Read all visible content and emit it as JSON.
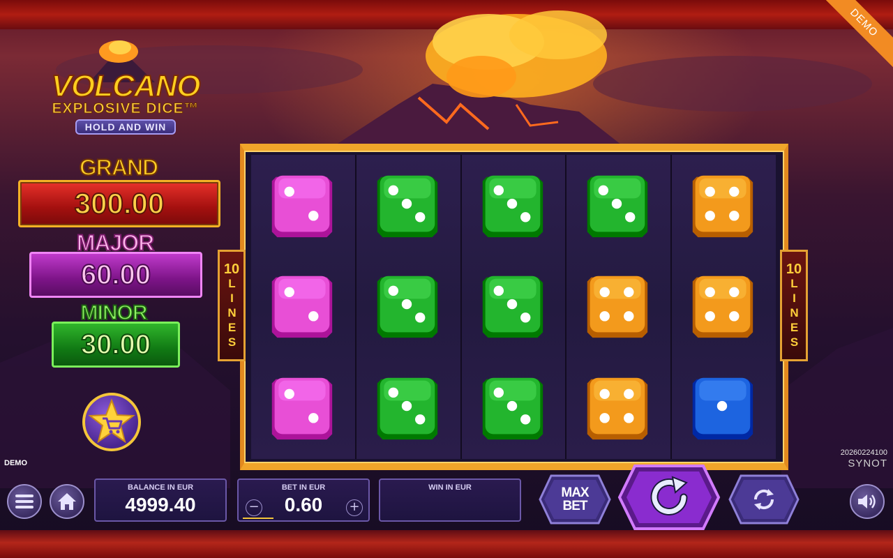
{
  "corner_badge": "DEMO",
  "logo": {
    "title": "VOLCANO",
    "subtitle": "EXPLOSIVE DICE™",
    "pill": "HOLD AND WIN"
  },
  "jackpots": {
    "grand": {
      "label": "GRAND",
      "value": "300.00"
    },
    "major": {
      "label": "MAJOR",
      "value": "60.00"
    },
    "minor": {
      "label": "MINOR",
      "value": "30.00"
    }
  },
  "lines": {
    "count": "10",
    "word": "LINES"
  },
  "reels": [
    [
      "pink-2",
      "pink-2",
      "pink-2"
    ],
    [
      "green-3",
      "green-3",
      "green-3"
    ],
    [
      "green-3",
      "green-3",
      "green-3"
    ],
    [
      "green-3",
      "orange-4",
      "orange-4"
    ],
    [
      "orange-4",
      "orange-4",
      "blue-1"
    ]
  ],
  "dice_colors": {
    "pink": "#e84fd6",
    "green": "#23b52e",
    "orange": "#f39a1c",
    "blue": "#1d64e0"
  },
  "status": {
    "mode": "DEMO",
    "build_id": "20260224100",
    "brand": "SYNOT"
  },
  "bottom_bar": {
    "balance_label": "BALANCE IN EUR",
    "balance_value": "4999.40",
    "bet_label": "BET IN EUR",
    "bet_value": "0.60",
    "win_label": "WIN IN EUR",
    "win_value": "",
    "max_bet_line1": "MAX",
    "max_bet_line2": "BET",
    "decrease": "−",
    "increase": "+"
  },
  "icons": {
    "menu": "menu-icon",
    "home": "home-icon",
    "shop": "cart-star-icon",
    "spin": "spin-icon",
    "autoplay": "autoplay-icon",
    "sound": "sound-icon"
  }
}
